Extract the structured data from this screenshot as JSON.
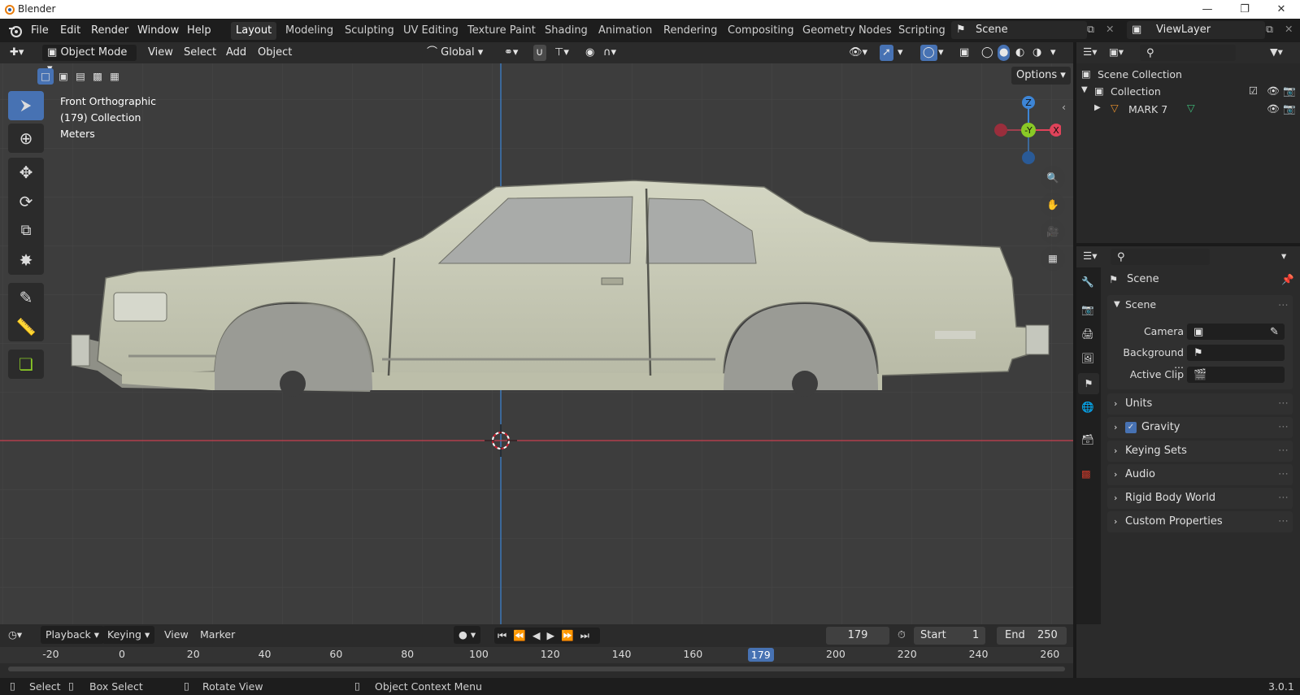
{
  "window": {
    "title": "Blender",
    "version": "3.0.1"
  },
  "menu": {
    "items": [
      "File",
      "Edit",
      "Render",
      "Window",
      "Help"
    ]
  },
  "workspaces": {
    "tabs": [
      "Layout",
      "Modeling",
      "Sculpting",
      "UV Editing",
      "Texture Paint",
      "Shading",
      "Animation",
      "Rendering",
      "Compositing",
      "Geometry Nodes",
      "Scripting"
    ],
    "active": "Layout"
  },
  "scene": {
    "name": "Scene"
  },
  "view_layer": {
    "name": "ViewLayer"
  },
  "viewport": {
    "mode": "Object Mode",
    "menus": [
      "View",
      "Select",
      "Add",
      "Object"
    ],
    "transform_orientation": "Global",
    "options_label": "Options",
    "overlay_info": {
      "view": "Front Orthographic",
      "collection": "(179) Collection",
      "units": "Meters"
    },
    "gizmo_axes": {
      "z": "Z",
      "y": "-Y",
      "x": "X"
    }
  },
  "outliner": {
    "root": "Scene Collection",
    "collection": "Collection",
    "object": "MARK 7"
  },
  "properties": {
    "context": "Scene",
    "section": "Scene",
    "camera_label": "Camera",
    "background_label": "Background ...",
    "active_clip_label": "Active Clip",
    "panels": [
      "Units",
      "Gravity",
      "Keying Sets",
      "Audio",
      "Rigid Body World",
      "Custom Properties"
    ],
    "gravity_checked": true
  },
  "timeline": {
    "menus": [
      "Playback",
      "Keying",
      "View",
      "Marker"
    ],
    "current_frame": "179",
    "start_label": "Start",
    "start": "1",
    "end_label": "End",
    "end": "250",
    "ticks": [
      "-20",
      "0",
      "20",
      "40",
      "60",
      "80",
      "100",
      "120",
      "140",
      "160",
      "179",
      "200",
      "220",
      "240",
      "260"
    ],
    "playhead_frame": 179
  },
  "status": {
    "select": "Select",
    "box_select": "Box Select",
    "rotate": "Rotate View",
    "context_menu": "Object Context Menu"
  },
  "colors": {
    "accent": "#4772b3",
    "x_axis": "#e0435a",
    "y_axis": "#8ac926",
    "z_axis": "#3d85d6",
    "car_body": "#c5c7b2"
  }
}
